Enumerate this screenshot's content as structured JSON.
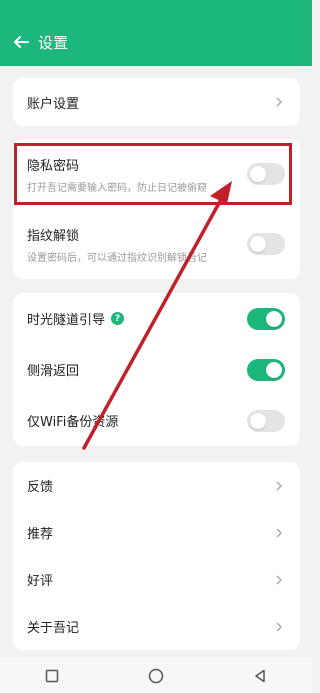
{
  "header": {
    "title": "设置",
    "back_icon": "arrow-left-icon"
  },
  "section_account": {
    "items": [
      {
        "label": "账户设置"
      }
    ]
  },
  "section_security": {
    "items": [
      {
        "label": "隐私密码",
        "sub": "打开吾记需要输入密码，防止日记被偷窥",
        "toggle": "off"
      },
      {
        "label": "指纹解锁",
        "sub": "设置密码后，可以通过指纹识别解锁吾记",
        "toggle": "off"
      }
    ]
  },
  "section_features": {
    "items": [
      {
        "label": "时光隧道引导",
        "help": "?",
        "toggle": "on"
      },
      {
        "label": "侧滑返回",
        "toggle": "on"
      },
      {
        "label": "仅WiFi备份资源",
        "toggle": "off"
      }
    ]
  },
  "section_more": {
    "items": [
      {
        "label": "反馈"
      },
      {
        "label": "推荐"
      },
      {
        "label": "好评"
      },
      {
        "label": "关于吾记"
      }
    ]
  },
  "colors": {
    "accent": "#1cb77b",
    "annotation": "#c0202a"
  }
}
